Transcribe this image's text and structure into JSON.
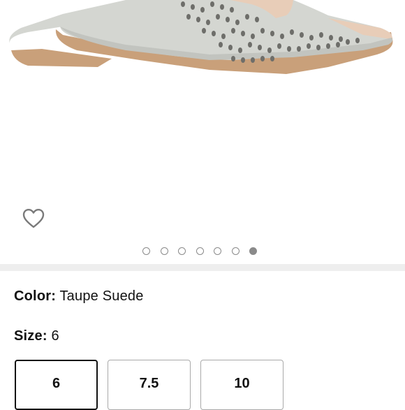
{
  "colors": {
    "suede": "#d4d6d1",
    "suede_shadow": "#c2c4bf",
    "sole": "#c9a07a",
    "lining": "#e8cdb8",
    "page_background": "#ffffff",
    "divider": "#eeeeee",
    "dot": "#8a8a8a",
    "selected_border": "#111111"
  },
  "wishlist": {
    "icon": "heart-outline-icon"
  },
  "gallery": {
    "image_count": 7,
    "active_index": 6
  },
  "color": {
    "label": "Color:",
    "value": "Taupe Suede"
  },
  "size": {
    "label": "Size:",
    "value": "6",
    "options": [
      "6",
      "7.5",
      "10"
    ],
    "selected_index": 0
  }
}
